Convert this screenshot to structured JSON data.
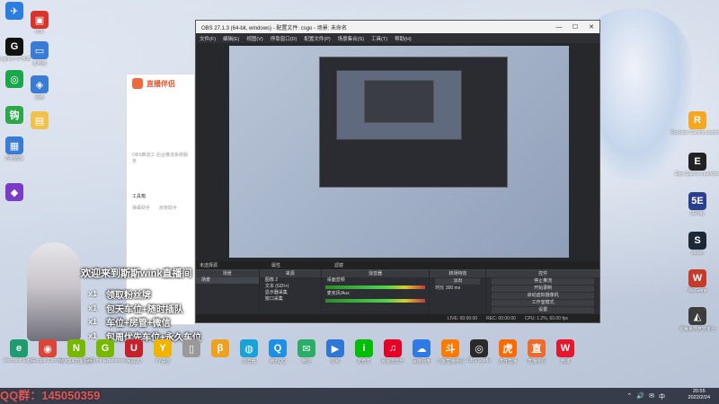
{
  "obs": {
    "title": "OBS 27.1.3 (64-bit, windows) - 配置文件: csgo - 场景: 未命名",
    "window_buttons": [
      "—",
      "☐",
      "✕"
    ],
    "menu": [
      "文件(F)",
      "编辑(E)",
      "视图(V)",
      "停靠窗口(D)",
      "配置文件(P)",
      "场景集合(S)",
      "工具(T)",
      "帮助(H)"
    ],
    "scene_label": "未选择源",
    "prop_tabs": [
      "属性",
      "滤镜"
    ],
    "docks": {
      "scenes": {
        "title": "场景",
        "items": [
          "场景"
        ]
      },
      "sources": {
        "title": "来源",
        "items": [
          "图像 2",
          "文本 (GDI+)",
          "显示器采集",
          "窗口采集"
        ]
      },
      "mixer": {
        "title": "混音器",
        "channels": [
          {
            "name": "桌面音频",
            "db": "0.0 dB"
          },
          {
            "name": "麦克风/Aux",
            "db": "0.0 dB"
          }
        ]
      },
      "transitions": {
        "title": "转场特效",
        "mode": "淡出",
        "duration_label": "时长",
        "duration": "300 ms"
      },
      "controls": {
        "title": "控件",
        "buttons": [
          "停止推流",
          "开始录制",
          "启动虚拟摄像机",
          "工作室模式",
          "设置",
          "退出"
        ]
      }
    },
    "status": {
      "live": "LIVE: 00:00:00",
      "rec": "REC: 00:00:00",
      "cpu": "CPU: 1.2%, 60.00 fps"
    }
  },
  "live_panel": {
    "brand": "直播伴侣",
    "placeholder": "OBS推流工 后台推流系统服务",
    "section": "工具箱",
    "tools": [
      "弹幕助手",
      "房管助手"
    ]
  },
  "overlay": {
    "welcome": "欢迎来到斯斯wink直播间",
    "perk_mark": "x1",
    "perks": [
      "领取粉丝牌",
      "包天车位+随时插队",
      "车位+房管+微信",
      "包周优先车位+永久车位"
    ]
  },
  "watermark": "QQ群：145050359",
  "desktop_left": [
    {
      "name": "bird-app-icon",
      "label": "",
      "color": "#2d7ce0",
      "glyph": "✈"
    },
    {
      "name": "pdf-icon",
      "label": "PDF",
      "color": "#d9342b",
      "glyph": "▣"
    },
    {
      "name": "logitech-icon",
      "label": "Logitech G HUB",
      "color": "#111111",
      "glyph": "G"
    },
    {
      "name": "computer-icon",
      "label": "此电脑",
      "color": "#3a7bd5",
      "glyph": "▭"
    },
    {
      "name": "app-yellow-icon",
      "label": "",
      "color": "#1aa64b",
      "glyph": "◎"
    },
    {
      "name": "network-icon",
      "label": "网络",
      "color": "#3a7bd5",
      "glyph": "◈"
    },
    {
      "name": "green-app-icon",
      "label": "",
      "color": "#2aa84a",
      "glyph": "钩"
    },
    {
      "name": "folder-icon",
      "label": "",
      "color": "#f0c14b",
      "glyph": "▤"
    },
    {
      "name": "control-panel-icon",
      "label": "控制面板",
      "color": "#3a7bd5",
      "glyph": "▦"
    },
    {
      "name": "game-icon",
      "label": "",
      "color": "#7a3cc7",
      "glyph": "◆"
    }
  ],
  "desktop_right": [
    {
      "name": "rockstar-icon",
      "label": "Rockstar Games Launcher",
      "color": "#f5a623",
      "glyph": "R"
    },
    {
      "name": "epic-icon",
      "label": "Epic Games Launcher",
      "color": "#222222",
      "glyph": "E"
    },
    {
      "name": "5e-icon",
      "label": "5EPlay",
      "color": "#2b3f8f",
      "glyph": "5E"
    },
    {
      "name": "steam-icon",
      "label": "steam",
      "color": "#1b2838",
      "glyph": "S"
    },
    {
      "name": "wegame-icon",
      "label": "WeGame",
      "color": "#c63a2a",
      "glyph": "W"
    },
    {
      "name": "pubg-icon",
      "label": "完美世界竞技平台",
      "color": "#3d3d3d",
      "glyph": "◭"
    }
  ],
  "bottom_apps": [
    {
      "name": "edge-icon",
      "label": "Microsoft Edge",
      "color": "#1f9c6e",
      "glyph": "e"
    },
    {
      "name": "chrome-icon",
      "label": "Google Chrome",
      "color": "#db4437",
      "glyph": "◉"
    },
    {
      "name": "nvidia-icon",
      "label": "NVIDIA 控制面板",
      "color": "#76b900",
      "glyph": "N"
    },
    {
      "name": "geforce-icon",
      "label": "GeForce Experience",
      "color": "#76b900",
      "glyph": "G"
    },
    {
      "name": "uu-icon",
      "label": "网易UU",
      "color": "#c8202a",
      "glyph": "U"
    },
    {
      "name": "yy-icon",
      "label": "YY语音",
      "color": "#f0b400",
      "glyph": "Y"
    },
    {
      "name": "tool-icon",
      "label": "",
      "color": "#999999",
      "glyph": "▯"
    },
    {
      "name": "beta-icon",
      "label": "",
      "color": "#f0a020",
      "glyph": "β"
    },
    {
      "name": "browser-icon",
      "label": "浏览器",
      "color": "#1aa1d6",
      "glyph": "◍"
    },
    {
      "name": "qq-icon",
      "label": "腾讯QQ",
      "color": "#1f8fe6",
      "glyph": "Q"
    },
    {
      "name": "wechat-icon",
      "label": "微信",
      "color": "#2aae67",
      "glyph": "✉"
    },
    {
      "name": "video-icon",
      "label": "视频",
      "color": "#2f77d6",
      "glyph": "▶"
    },
    {
      "name": "iqiyi-icon",
      "label": "爱奇艺",
      "color": "#00be06",
      "glyph": "i"
    },
    {
      "name": "netease-music-icon",
      "label": "网易云音乐",
      "color": "#e60026",
      "glyph": "♫"
    },
    {
      "name": "baidu-icon",
      "label": "百度网盘",
      "color": "#2f7ae5",
      "glyph": "☁"
    },
    {
      "name": "douyu-icon",
      "label": "斗鱼直播伴侣",
      "color": "#ff7a00",
      "glyph": "斗"
    },
    {
      "name": "obs-icon",
      "label": "OBS Studio",
      "color": "#2a2a2a",
      "glyph": "◎"
    },
    {
      "name": "huya-icon",
      "label": "虎牙直播",
      "color": "#ff6a00",
      "glyph": "虎"
    },
    {
      "name": "live-helper-icon",
      "label": "直播伴侣",
      "color": "#f06a2a",
      "glyph": "直"
    },
    {
      "name": "weibo-icon",
      "label": "微博",
      "color": "#e6162d",
      "glyph": "W"
    }
  ],
  "tray": {
    "time": "20:55",
    "date": "2022/2/24",
    "icons": [
      "⌃",
      "🔊",
      "✉",
      "中"
    ]
  }
}
